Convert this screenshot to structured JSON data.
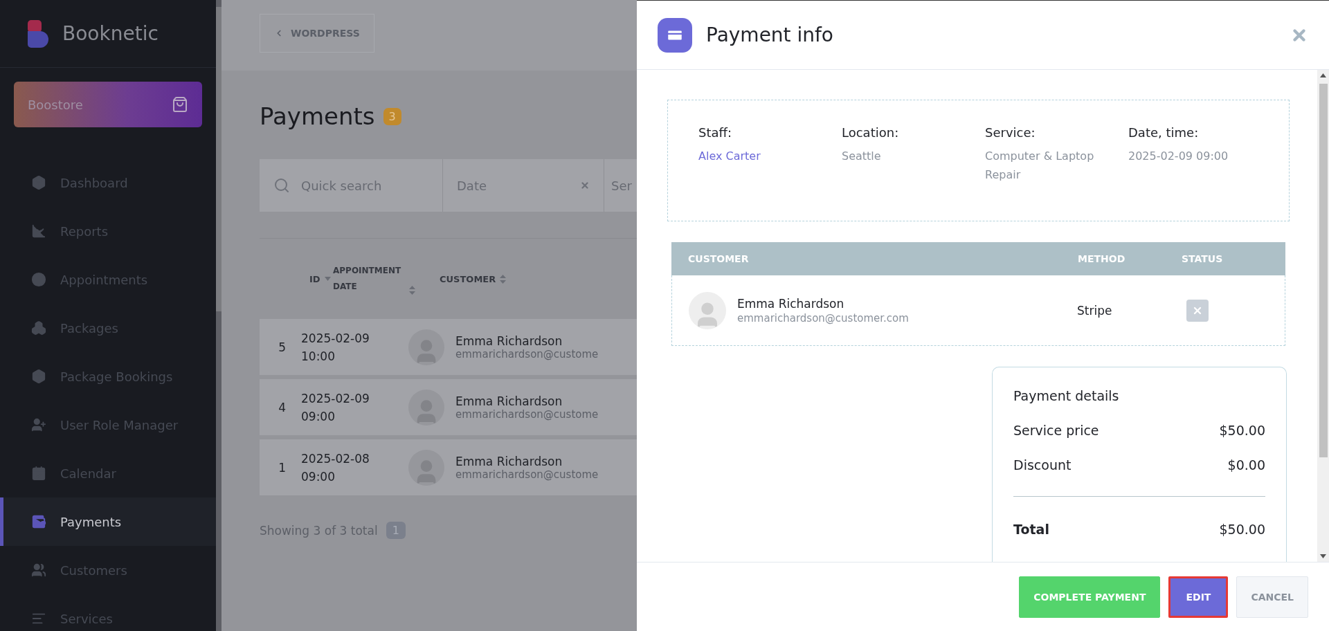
{
  "sidebar": {
    "brand": "Booknetic",
    "store_button": "Boostore",
    "items": [
      {
        "label": "Dashboard",
        "selected": false
      },
      {
        "label": "Reports",
        "selected": false
      },
      {
        "label": "Appointments",
        "selected": false
      },
      {
        "label": "Packages",
        "selected": false
      },
      {
        "label": "Package Bookings",
        "selected": false
      },
      {
        "label": "User Role Manager",
        "selected": false
      },
      {
        "label": "Calendar",
        "selected": false
      },
      {
        "label": "Payments",
        "selected": true
      },
      {
        "label": "Customers",
        "selected": false
      },
      {
        "label": "Services",
        "selected": false
      }
    ]
  },
  "topbar": {
    "back_button": "WORDPRESS"
  },
  "page": {
    "title": "Payments",
    "count": "3",
    "filters": [
      {
        "kind": "search",
        "placeholder": "Quick search"
      },
      {
        "kind": "date",
        "placeholder": "Date"
      },
      {
        "kind": "select",
        "placeholder": "Ser"
      }
    ],
    "table": {
      "columns": [
        {
          "label": "ID",
          "sorted": true
        },
        {
          "label": "APPOINTMENT DATE",
          "sorted": false
        },
        {
          "label": "CUSTOMER",
          "sorted": false
        }
      ],
      "rows": [
        {
          "id": "5",
          "date": "2025-02-09",
          "time": "10:00",
          "name": "Emma Richardson",
          "email": "emmarichardson@custome"
        },
        {
          "id": "4",
          "date": "2025-02-09",
          "time": "09:00",
          "name": "Emma Richardson",
          "email": "emmarichardson@custome"
        },
        {
          "id": "1",
          "date": "2025-02-08",
          "time": "09:00",
          "name": "Emma Richardson",
          "email": "emmarichardson@custome"
        }
      ]
    },
    "footer": {
      "showing": "Showing 3 of 3 total",
      "pages": [
        {
          "label": "1",
          "selected": true
        }
      ]
    }
  },
  "modal": {
    "title": "Payment info",
    "info": [
      {
        "label": "Staff:",
        "value": "Alex Carter",
        "kind": "link"
      },
      {
        "label": "Location:",
        "value": "Seattle",
        "kind": "text"
      },
      {
        "label": "Service:",
        "value": "Computer & Laptop Repair",
        "kind": "text"
      },
      {
        "label": "Date, time:",
        "value": "2025-02-09 09:00",
        "kind": "text"
      }
    ],
    "customer_table": {
      "columns": [
        "CUSTOMER",
        "METHOD",
        "STATUS"
      ],
      "rows": [
        {
          "name": "Emma Richardson",
          "email": "emmarichardson@customer.com",
          "method": "Stripe",
          "paid": false
        }
      ]
    },
    "details": {
      "title": "Payment details",
      "lines": [
        {
          "label": "Service price",
          "value": "$50.00",
          "kind": "line"
        },
        {
          "label": "Discount",
          "value": "$0.00",
          "kind": "line"
        },
        {
          "label": "Total",
          "value": "$50.00",
          "kind": "total"
        }
      ]
    },
    "buttons": [
      {
        "label": "COMPLETE PAYMENT",
        "kind": "success",
        "focused": false
      },
      {
        "label": "EDIT",
        "kind": "primary",
        "focused": true
      },
      {
        "label": "CANCEL",
        "kind": "secondary",
        "focused": false
      }
    ]
  }
}
